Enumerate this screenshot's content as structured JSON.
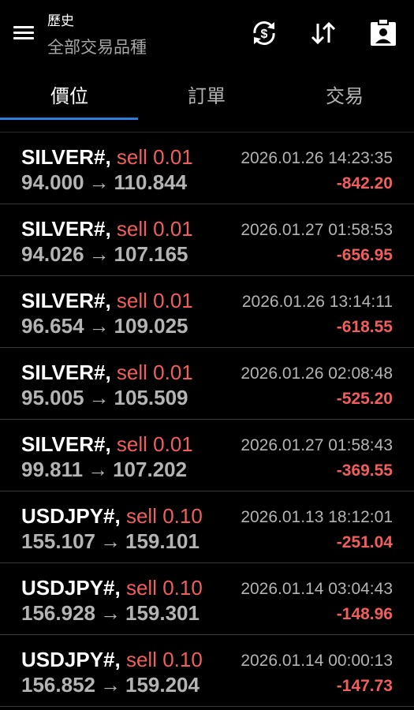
{
  "header": {
    "title": "歷史",
    "subtitle": "全部交易品種",
    "menu_icon": "hamburger-menu-icon",
    "icons": [
      "sync-currency-icon",
      "sort-arrows-icon",
      "report-clipboard-icon"
    ]
  },
  "tabs": [
    {
      "label": "價位",
      "active": true
    },
    {
      "label": "訂單",
      "active": false
    },
    {
      "label": "交易",
      "active": false
    }
  ],
  "colors": {
    "accent": "#2d7ddb",
    "loss": "#f25d5d",
    "muted": "#b4b4b4",
    "background": "#000000"
  },
  "trades": [
    {
      "symbol": "SILVER#,",
      "side": "sell 0.01",
      "open": "94.000",
      "arrow": "→",
      "close": "110.844",
      "time": "2026.01.26 14:23:35",
      "profit": "-842.20"
    },
    {
      "symbol": "SILVER#,",
      "side": "sell 0.01",
      "open": "94.026",
      "arrow": "→",
      "close": "107.165",
      "time": "2026.01.27 01:58:53",
      "profit": "-656.95"
    },
    {
      "symbol": "SILVER#,",
      "side": "sell 0.01",
      "open": "96.654",
      "arrow": "→",
      "close": "109.025",
      "time": "2026.01.26 13:14:11",
      "profit": "-618.55"
    },
    {
      "symbol": "SILVER#,",
      "side": "sell 0.01",
      "open": "95.005",
      "arrow": "→",
      "close": "105.509",
      "time": "2026.01.26 02:08:48",
      "profit": "-525.20"
    },
    {
      "symbol": "SILVER#,",
      "side": "sell 0.01",
      "open": "99.811",
      "arrow": "→",
      "close": "107.202",
      "time": "2026.01.27 01:58:43",
      "profit": "-369.55"
    },
    {
      "symbol": "USDJPY#,",
      "side": "sell 0.10",
      "open": "155.107",
      "arrow": "→",
      "close": "159.101",
      "time": "2026.01.13 18:12:01",
      "profit": "-251.04"
    },
    {
      "symbol": "USDJPY#,",
      "side": "sell 0.10",
      "open": "156.928",
      "arrow": "→",
      "close": "159.301",
      "time": "2026.01.14 03:04:43",
      "profit": "-148.96"
    },
    {
      "symbol": "USDJPY#,",
      "side": "sell 0.10",
      "open": "156.852",
      "arrow": "→",
      "close": "159.204",
      "time": "2026.01.14 00:00:13",
      "profit": "-147.73"
    }
  ]
}
